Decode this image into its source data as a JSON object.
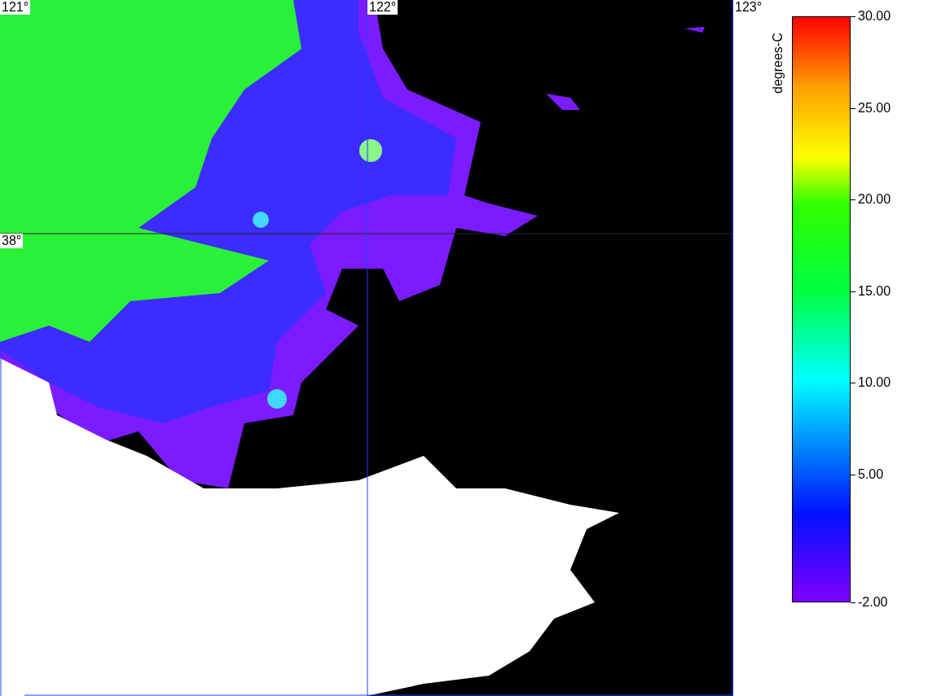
{
  "map": {
    "longitude_labels": [
      "121°",
      "122°",
      "123°"
    ],
    "latitude_labels": [
      "38°"
    ]
  },
  "colorbar": {
    "title": "degrees-C",
    "ticks": [
      "30.00",
      "25.00",
      "20.00",
      "15.00",
      "10.00",
      "5.00",
      "-2.00"
    ]
  }
}
